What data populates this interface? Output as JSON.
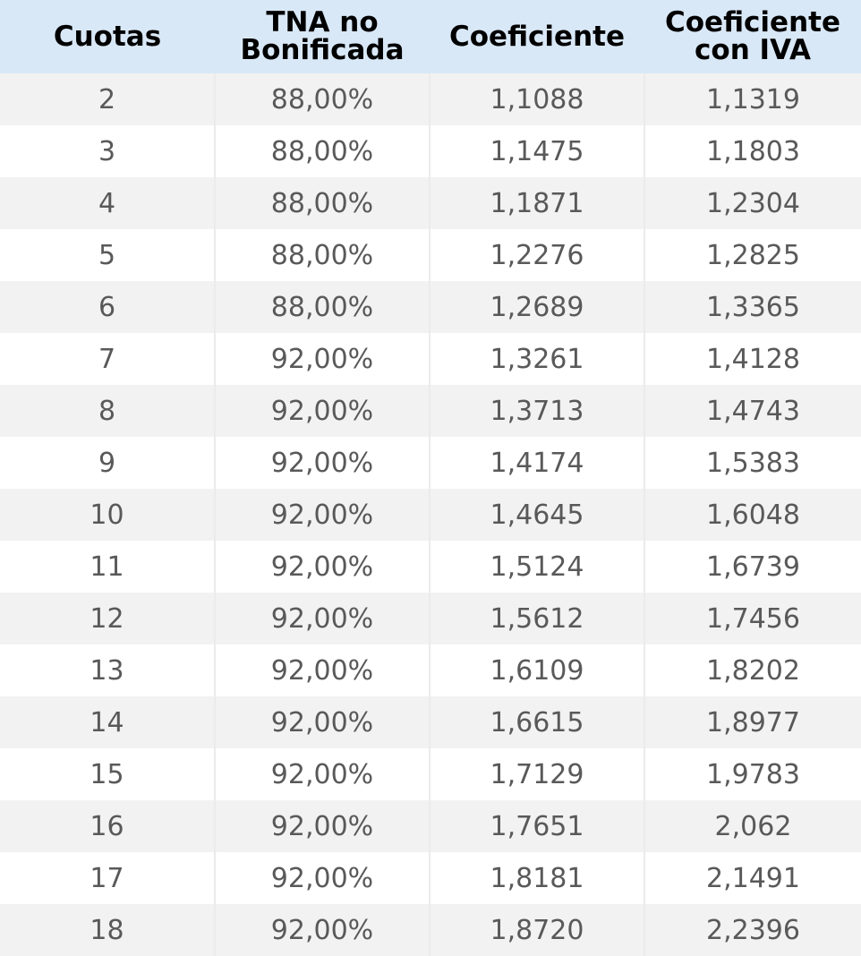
{
  "header": {
    "cuotas": [
      "Cuotas"
    ],
    "tna": [
      "TNA no",
      "Bonificada"
    ],
    "coef": [
      "Coeficiente"
    ],
    "coef_iva": [
      "Coeficiente",
      "con IVA"
    ]
  },
  "rows": [
    {
      "cuotas": "2",
      "tna": "88,00%",
      "coef": "1,1088",
      "coef_iva": "1,1319"
    },
    {
      "cuotas": "3",
      "tna": "88,00%",
      "coef": "1,1475",
      "coef_iva": "1,1803"
    },
    {
      "cuotas": "4",
      "tna": "88,00%",
      "coef": "1,1871",
      "coef_iva": "1,2304"
    },
    {
      "cuotas": "5",
      "tna": "88,00%",
      "coef": "1,2276",
      "coef_iva": "1,2825"
    },
    {
      "cuotas": "6",
      "tna": "88,00%",
      "coef": "1,2689",
      "coef_iva": "1,3365"
    },
    {
      "cuotas": "7",
      "tna": "92,00%",
      "coef": "1,3261",
      "coef_iva": "1,4128"
    },
    {
      "cuotas": "8",
      "tna": "92,00%",
      "coef": "1,3713",
      "coef_iva": "1,4743"
    },
    {
      "cuotas": "9",
      "tna": "92,00%",
      "coef": "1,4174",
      "coef_iva": "1,5383"
    },
    {
      "cuotas": "10",
      "tna": "92,00%",
      "coef": "1,4645",
      "coef_iva": "1,6048"
    },
    {
      "cuotas": "11",
      "tna": "92,00%",
      "coef": "1,5124",
      "coef_iva": "1,6739"
    },
    {
      "cuotas": "12",
      "tna": "92,00%",
      "coef": "1,5612",
      "coef_iva": "1,7456"
    },
    {
      "cuotas": "13",
      "tna": "92,00%",
      "coef": "1,6109",
      "coef_iva": "1,8202"
    },
    {
      "cuotas": "14",
      "tna": "92,00%",
      "coef": "1,6615",
      "coef_iva": "1,8977"
    },
    {
      "cuotas": "15",
      "tna": "92,00%",
      "coef": "1,7129",
      "coef_iva": "1,9783"
    },
    {
      "cuotas": "16",
      "tna": "92,00%",
      "coef": "1,7651",
      "coef_iva": "2,062"
    },
    {
      "cuotas": "17",
      "tna": "92,00%",
      "coef": "1,8181",
      "coef_iva": "2,1491"
    },
    {
      "cuotas": "18",
      "tna": "92,00%",
      "coef": "1,8720",
      "coef_iva": "2,2396"
    }
  ]
}
